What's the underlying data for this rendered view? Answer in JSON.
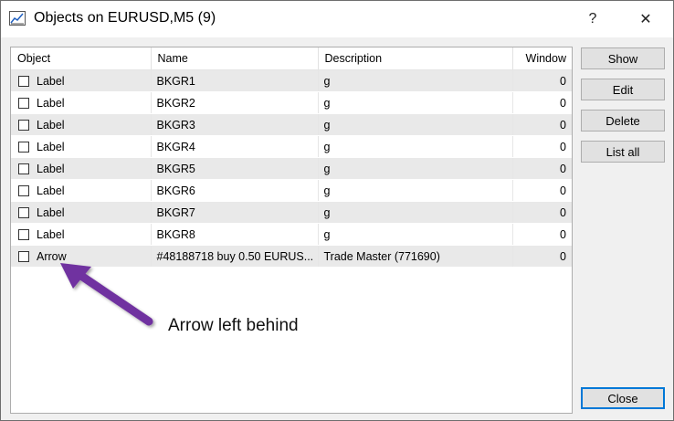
{
  "window": {
    "title": "Objects on EURUSD,M5 (9)",
    "help_label": "?",
    "close_label": "✕"
  },
  "table": {
    "columns": [
      "Object",
      "Name",
      "Description",
      "Window"
    ],
    "rows": [
      {
        "object": "Label",
        "name": "BKGR1",
        "description": "g",
        "window": "0",
        "checked": false
      },
      {
        "object": "Label",
        "name": "BKGR2",
        "description": "g",
        "window": "0",
        "checked": false
      },
      {
        "object": "Label",
        "name": "BKGR3",
        "description": "g",
        "window": "0",
        "checked": false
      },
      {
        "object": "Label",
        "name": "BKGR4",
        "description": "g",
        "window": "0",
        "checked": false
      },
      {
        "object": "Label",
        "name": "BKGR5",
        "description": "g",
        "window": "0",
        "checked": false
      },
      {
        "object": "Label",
        "name": "BKGR6",
        "description": "g",
        "window": "0",
        "checked": false
      },
      {
        "object": "Label",
        "name": "BKGR7",
        "description": "g",
        "window": "0",
        "checked": false
      },
      {
        "object": "Label",
        "name": "BKGR8",
        "description": "g",
        "window": "0",
        "checked": false
      },
      {
        "object": "Arrow",
        "name": "#48188718 buy 0.50 EURUS...",
        "description": "Trade Master (771690)",
        "window": "0",
        "checked": false
      }
    ]
  },
  "buttons": {
    "show": "Show",
    "edit": "Edit",
    "delete": "Delete",
    "list_all": "List all",
    "close": "Close"
  },
  "annotation": {
    "text": "Arrow left behind",
    "arrow_color": "#7030a0"
  },
  "colors": {
    "focus_border": "#0078d7",
    "row_shade": "#e9e9e9"
  }
}
